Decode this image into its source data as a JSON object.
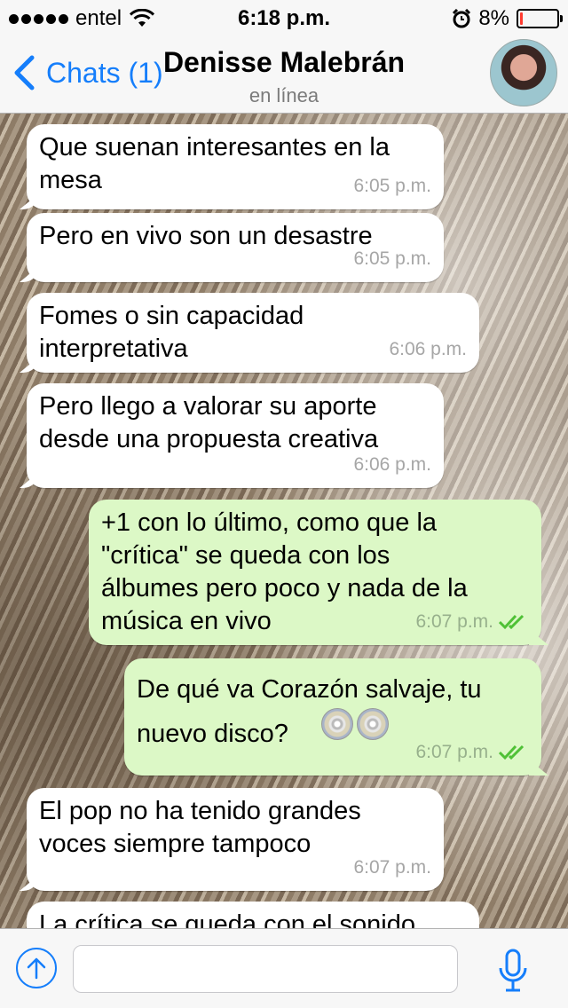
{
  "status_bar": {
    "carrier": "entel",
    "time": "6:18 p.m.",
    "battery_percent": "8%",
    "battery_level": 0.08,
    "battery_color": "#ff3b30",
    "signal_icon": "signal-dots-icon",
    "wifi_icon": "wifi-icon",
    "alarm_icon": "alarm-clock-icon"
  },
  "nav": {
    "back_label": "Chats (1)",
    "contact_name": "Denisse Malebrán",
    "status": "en línea",
    "accent_color": "#157efb"
  },
  "messages": [
    {
      "dir": "in",
      "text": "Que suenan interesantes en la\nmesa",
      "time": "6:05 p.m."
    },
    {
      "dir": "in",
      "text": "Pero en vivo son un desastre",
      "time": "6:05 p.m."
    },
    {
      "dir": "in",
      "text": "Fomes o sin capacidad\ninterpretativa",
      "time": "6:06 p.m."
    },
    {
      "dir": "in",
      "text": "Pero llego a valorar su aporte\ndesde una propuesta creativa",
      "time": "6:06 p.m."
    },
    {
      "dir": "out",
      "text": "+1 con lo último, como que la\n\"crítica\" se queda con los\nálbumes pero poco y nada de la\nmúsica en vivo",
      "time": "6:07 p.m.",
      "read": true
    },
    {
      "dir": "out",
      "text": "De qué va Corazón salvaje, tu\nnuevo disco?",
      "emoji": "cd-disc-icon",
      "time": "6:07 p.m.",
      "read": true
    },
    {
      "dir": "in",
      "text": "El pop no ha tenido grandes\nvoces siempre tampoco",
      "time": "6:07 p.m."
    },
    {
      "dir": "in",
      "text": "La crítica se queda con el sonido",
      "time": ""
    }
  ],
  "composer": {
    "value": "",
    "placeholder": "",
    "share_icon": "upload-arrow-icon",
    "mic_icon": "microphone-icon"
  },
  "colors": {
    "incoming_bubble": "#ffffff",
    "outgoing_bubble": "#dcf8c6",
    "read_ticks": "#4fc136"
  }
}
